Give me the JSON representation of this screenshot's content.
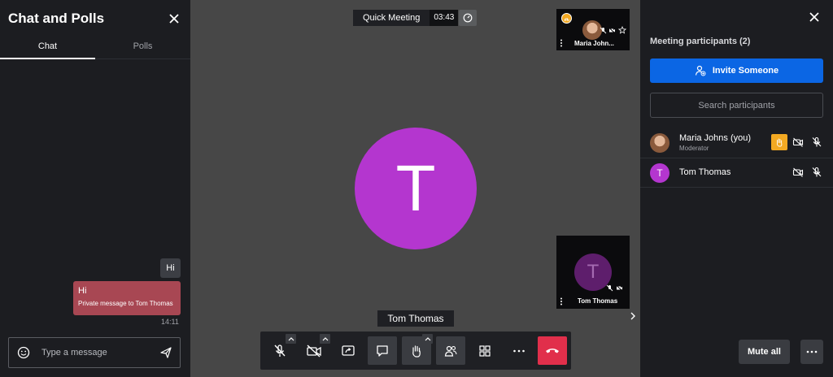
{
  "chat": {
    "title": "Chat and Polls",
    "tabs": [
      {
        "label": "Chat",
        "active": true
      },
      {
        "label": "Polls",
        "active": false
      }
    ],
    "messages": [
      {
        "text": "Hi"
      },
      {
        "text": "Hi",
        "subtext": "Private message to Tom Thomas",
        "time": "14:11"
      }
    ],
    "compose_placeholder": "Type a message"
  },
  "stage": {
    "meeting_name": "Quick Meeting",
    "timer": "03:43",
    "main_initial": "T",
    "speaker_label": "Tom Thomas",
    "thumbnails": [
      {
        "name": "Maria John...",
        "badge_color": "#f3a922"
      },
      {
        "name": "Tom Thomas",
        "initial": "T"
      }
    ],
    "toolbar": [
      "mic-off",
      "camera-off",
      "share-screen",
      "chat",
      "raise-hand",
      "participants",
      "tile-view",
      "more",
      "hangup"
    ]
  },
  "participants": {
    "heading": "Meeting participants (2)",
    "invite_label": "Invite Someone",
    "search_placeholder": "Search participants",
    "list": [
      {
        "name": "Maria Johns (you)",
        "role": "Moderator",
        "hand_raised": true
      },
      {
        "name": "Tom Thomas",
        "initial": "T"
      }
    ],
    "mute_all_label": "Mute all"
  },
  "colors": {
    "accent_blue": "#0b66e4",
    "avatar_purple": "#b436cf",
    "hangup_red": "#e12f4b",
    "hand_yellow": "#f3a922",
    "private_msg": "#a84753"
  }
}
